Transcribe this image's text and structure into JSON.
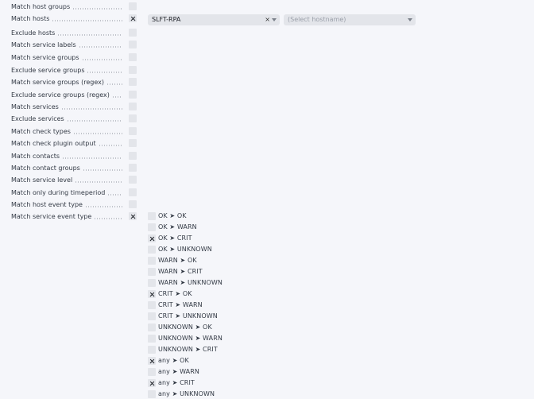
{
  "conditions": [
    {
      "label": "Match host groups",
      "checked": false
    },
    {
      "label": "Match hosts",
      "checked": true
    },
    {
      "label": "Exclude hosts",
      "checked": false
    },
    {
      "label": "Match service labels",
      "checked": false
    },
    {
      "label": "Match service groups",
      "checked": false
    },
    {
      "label": "Exclude service groups",
      "checked": false
    },
    {
      "label": "Match service groups (regex)",
      "checked": false
    },
    {
      "label": "Exclude service groups (regex)",
      "checked": false
    },
    {
      "label": "Match services",
      "checked": false
    },
    {
      "label": "Exclude services",
      "checked": false
    },
    {
      "label": "Match check types",
      "checked": false
    },
    {
      "label": "Match check plugin output",
      "checked": false
    },
    {
      "label": "Match contacts",
      "checked": false
    },
    {
      "label": "Match contact groups",
      "checked": false
    },
    {
      "label": "Match service level",
      "checked": false
    },
    {
      "label": "Match only during timeperiod",
      "checked": false
    },
    {
      "label": "Match host event type",
      "checked": false
    },
    {
      "label": "Match service event type",
      "checked": true
    }
  ],
  "hosts": {
    "selected_value": "SLFT-RPA",
    "clear_symbol": "×",
    "placeholder": "(Select hostname)"
  },
  "event_types": [
    {
      "label": "OK ➤ OK",
      "checked": false
    },
    {
      "label": "OK ➤ WARN",
      "checked": false
    },
    {
      "label": "OK ➤ CRIT",
      "checked": true
    },
    {
      "label": "OK ➤ UNKNOWN",
      "checked": false
    },
    {
      "label": "WARN ➤ OK",
      "checked": false
    },
    {
      "label": "WARN ➤ CRIT",
      "checked": false
    },
    {
      "label": "WARN ➤ UNKNOWN",
      "checked": false
    },
    {
      "label": "CRIT ➤ OK",
      "checked": true
    },
    {
      "label": "CRIT ➤ WARN",
      "checked": false
    },
    {
      "label": "CRIT ➤ UNKNOWN",
      "checked": false
    },
    {
      "label": "UNKNOWN ➤ OK",
      "checked": false
    },
    {
      "label": "UNKNOWN ➤ WARN",
      "checked": false
    },
    {
      "label": "UNKNOWN ➤ CRIT",
      "checked": false
    },
    {
      "label": "any ➤ OK",
      "checked": true
    },
    {
      "label": "any ➤ WARN",
      "checked": false
    },
    {
      "label": "any ➤ CRIT",
      "checked": true
    },
    {
      "label": "any ➤ UNKNOWN",
      "checked": false
    }
  ]
}
